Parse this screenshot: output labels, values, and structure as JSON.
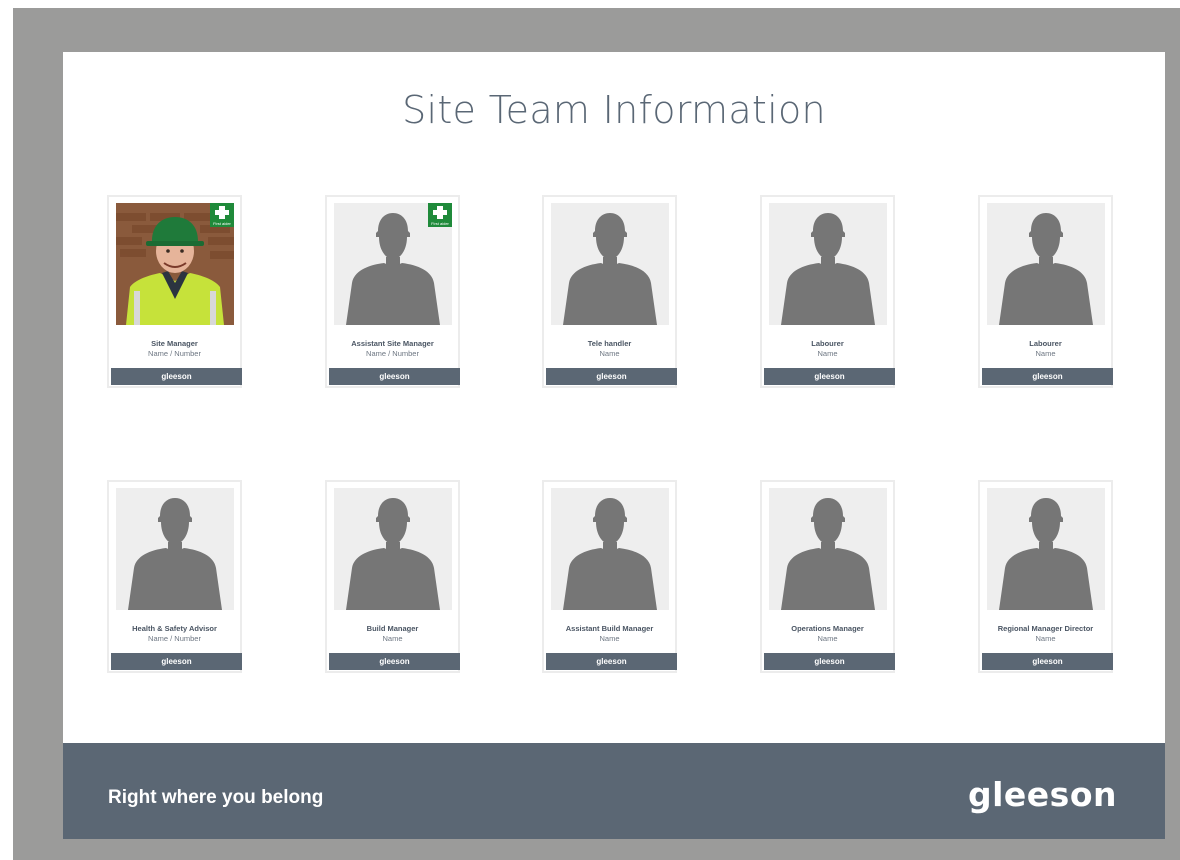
{
  "page": {
    "title": "Site Team Information"
  },
  "cards": [
    {
      "role": "Site Manager",
      "sub": "Name / Number",
      "brand": "gleeson",
      "photo": "person-photo",
      "first_aider": true,
      "first_aider_text": "First aider"
    },
    {
      "role": "Assistant Site Manager",
      "sub": "Name / Number",
      "brand": "gleeson",
      "photo": "silhouette",
      "first_aider": true,
      "first_aider_text": "First aider"
    },
    {
      "role": "Tele handler",
      "sub": "Name",
      "brand": "gleeson",
      "photo": "silhouette",
      "first_aider": false
    },
    {
      "role": "Labourer",
      "sub": "Name",
      "brand": "gleeson",
      "photo": "silhouette",
      "first_aider": false
    },
    {
      "role": "Labourer",
      "sub": "Name",
      "brand": "gleeson",
      "photo": "silhouette",
      "first_aider": false
    },
    {
      "role": "Health & Safety Advisor",
      "sub": "Name / Number",
      "brand": "gleeson",
      "photo": "silhouette",
      "first_aider": false
    },
    {
      "role": "Build Manager",
      "sub": "Name",
      "brand": "gleeson",
      "photo": "silhouette",
      "first_aider": false
    },
    {
      "role": "Assistant Build Manager",
      "sub": "Name",
      "brand": "gleeson",
      "photo": "silhouette",
      "first_aider": false
    },
    {
      "role": "Operations Manager",
      "sub": "Name",
      "brand": "gleeson",
      "photo": "silhouette",
      "first_aider": false
    },
    {
      "role": "Regional Manager Director",
      "sub": "Name",
      "brand": "gleeson",
      "photo": "silhouette",
      "first_aider": false
    }
  ],
  "footer": {
    "tagline": "Right where you belong",
    "logo": "gleeson"
  },
  "colors": {
    "frame": "#9b9b9a",
    "brand_slate": "#5b6774",
    "first_aid_green": "#1f8a3a",
    "placeholder_bg": "#eeeeee",
    "silhouette": "#767676"
  },
  "icons": {
    "first_aid": "first-aid-cross-icon",
    "placeholder": "person-silhouette-icon"
  }
}
